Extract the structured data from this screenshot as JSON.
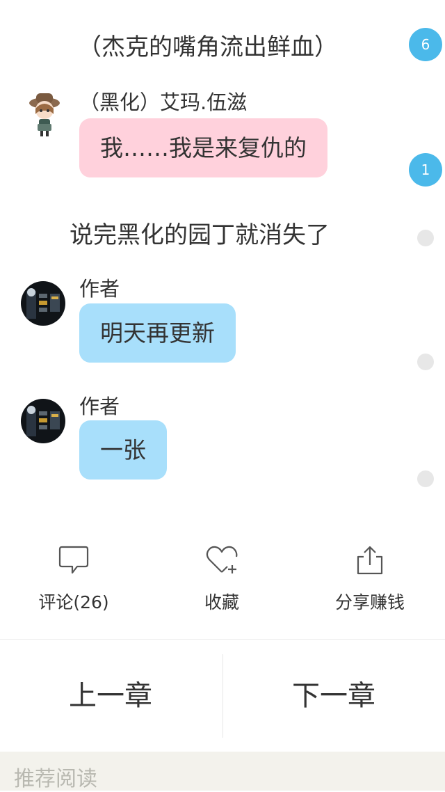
{
  "chat": {
    "narration_1": "（杰克的嘴角流出鲜血）",
    "badge_1": "6",
    "message_1": {
      "speaker": "（黑化）艾玛.伍滋",
      "text": "我……我是来复仇的"
    },
    "badge_2": "1",
    "narration_2": "说完黑化的园丁就消失了",
    "message_2": {
      "speaker": "作者",
      "text": "明天再更新"
    },
    "message_3": {
      "speaker": "作者",
      "text": "一张"
    }
  },
  "actions": {
    "comment": {
      "label": "评论(26)",
      "icon": "speech-bubble-icon"
    },
    "favorite": {
      "label": "收藏",
      "icon": "heart-plus-icon"
    },
    "share": {
      "label": "分享赚钱",
      "icon": "share-icon"
    }
  },
  "navigation": {
    "prev_chapter": "上一章",
    "next_chapter": "下一章"
  },
  "recommended": {
    "label": "推荐阅读"
  },
  "colors": {
    "pink_bubble": "#ffd1dc",
    "blue_bubble": "#a8dffb",
    "badge": "#4bb9ea",
    "recommend_bar": "#f3f2ec"
  }
}
